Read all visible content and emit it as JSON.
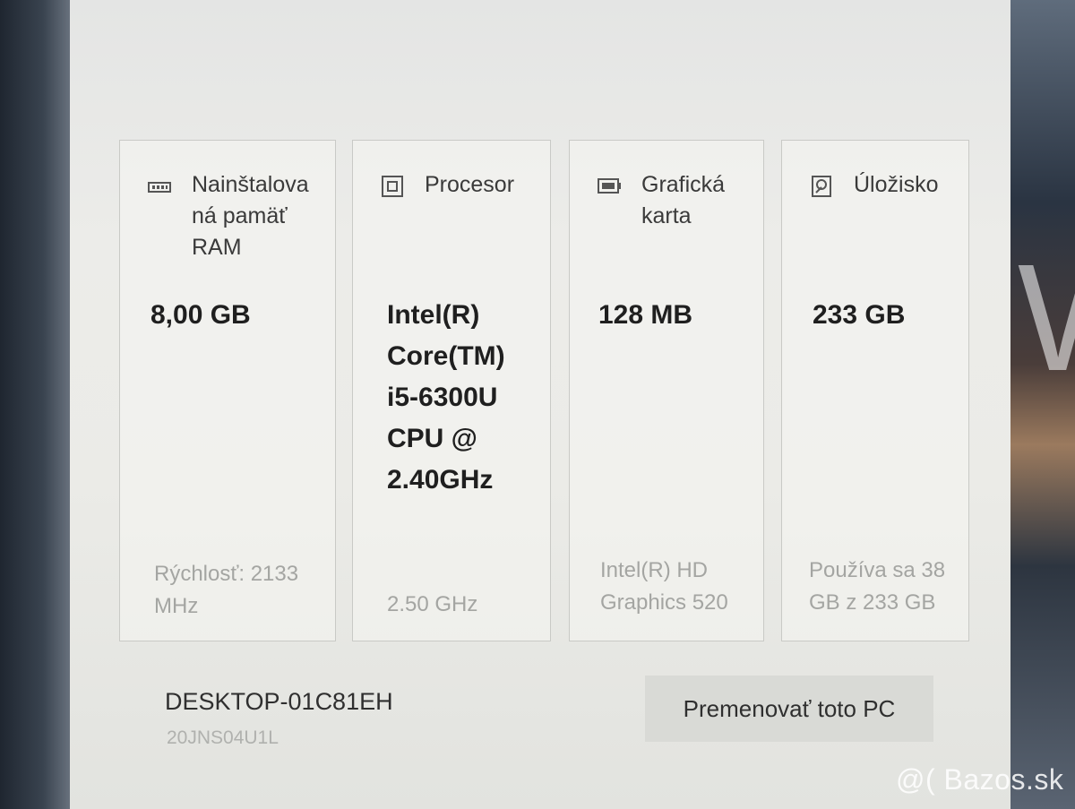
{
  "cards": [
    {
      "title": "Nainštalova ná pamäť RAM",
      "icon": "ram-icon",
      "value": "8,00 GB",
      "detail": "Rýchlosť: 2133 MHz"
    },
    {
      "title": "Procesor",
      "icon": "processor-icon",
      "value": "Intel(R) Core(TM) i5-6300U CPU @ 2.40GHz",
      "detail": "2.50 GHz"
    },
    {
      "title": "Grafická karta",
      "icon": "graphics-card-icon",
      "value": "128 MB",
      "detail": "Intel(R) HD Graphics 520"
    },
    {
      "title": "Úložisko",
      "icon": "storage-icon",
      "value": "233 GB",
      "detail": "Používa sa 38 GB z 233 GB"
    }
  ],
  "device": {
    "name": "DESKTOP-01C81EH",
    "model": "20JNS04U1L"
  },
  "rename_button_label": "Premenovať toto PC",
  "watermark": "@( Bazos.sk"
}
